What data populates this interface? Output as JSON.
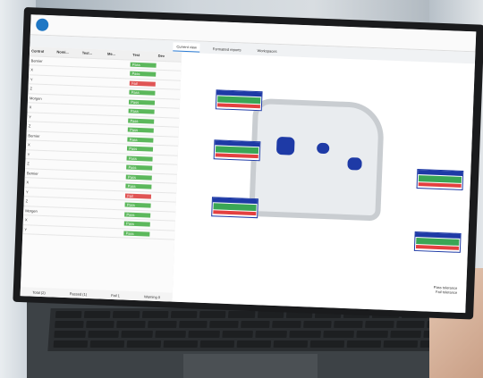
{
  "app": {
    "tabs": [
      "Current view",
      "Formatted reports",
      "Workspaces"
    ],
    "report_button": "Report",
    "export_button": "Open in Polyworks"
  },
  "table": {
    "headers": [
      "Control",
      "Nomi...",
      "Test...",
      "Me...",
      "Test",
      "Dev"
    ],
    "rows": [
      {
        "label": "Bernier",
        "status": "Pass"
      },
      {
        "label": "X",
        "status": "Pass"
      },
      {
        "label": "Y",
        "status": "Fail"
      },
      {
        "label": "Z",
        "status": "Pass"
      },
      {
        "label": "Morgen",
        "status": "Pass"
      },
      {
        "label": "X",
        "status": "Pass"
      },
      {
        "label": "Y",
        "status": "Pass"
      },
      {
        "label": "Z",
        "status": "Pass"
      },
      {
        "label": "Bernier",
        "status": "Pass"
      },
      {
        "label": "X",
        "status": "Pass"
      },
      {
        "label": "Y",
        "status": "Pass"
      },
      {
        "label": "Z",
        "status": "Pass"
      },
      {
        "label": "Bernier",
        "status": "Pass"
      },
      {
        "label": "X",
        "status": "Pass"
      },
      {
        "label": "Y",
        "status": "Fail"
      },
      {
        "label": "Z",
        "status": "Pass"
      },
      {
        "label": "Morgen",
        "status": "Pass"
      },
      {
        "label": "X",
        "status": "Pass"
      },
      {
        "label": "Y",
        "status": "Pass"
      }
    ]
  },
  "status": {
    "total": "Total (2)",
    "passed": "Passed (1)",
    "failed": "Fail 1",
    "warning": "Warning 0"
  },
  "legend": {
    "line1": "Pass tolerance",
    "line2": "Fail tolerance"
  },
  "colors": {
    "pass": "#5cb85c",
    "fail": "#e05555",
    "accent": "#1e3aa6"
  }
}
